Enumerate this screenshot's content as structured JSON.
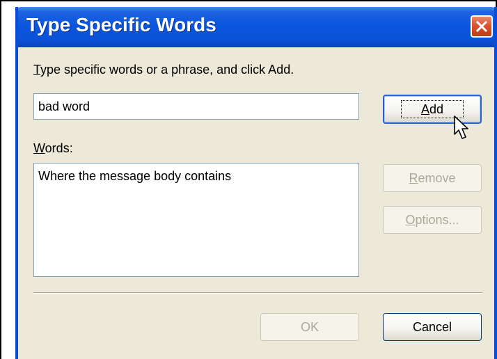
{
  "dialog": {
    "title": "Type Specific Words",
    "instruction": {
      "mnemonic": "T",
      "rest": "ype specific words or a phrase, and click Add."
    },
    "word_input": {
      "value": "bad word"
    },
    "words_label": {
      "mnemonic": "W",
      "rest": "ords:"
    },
    "words_list": [
      "Where the message body contains"
    ],
    "buttons": {
      "add": {
        "mnemonic": "A",
        "rest": "dd"
      },
      "remove": {
        "mnemonic": "R",
        "rest": "emove"
      },
      "options": {
        "mnemonic": "O",
        "rest": "ptions..."
      },
      "ok": "OK",
      "cancel": "Cancel"
    }
  },
  "icons": {
    "close": "close-icon",
    "cursor": "mouse-pointer-icon"
  },
  "colors": {
    "titlebar": "#0a56de",
    "dialog_background": "#ece9d8",
    "close_button": "#d9542e",
    "disabled_text": "#aca899"
  }
}
